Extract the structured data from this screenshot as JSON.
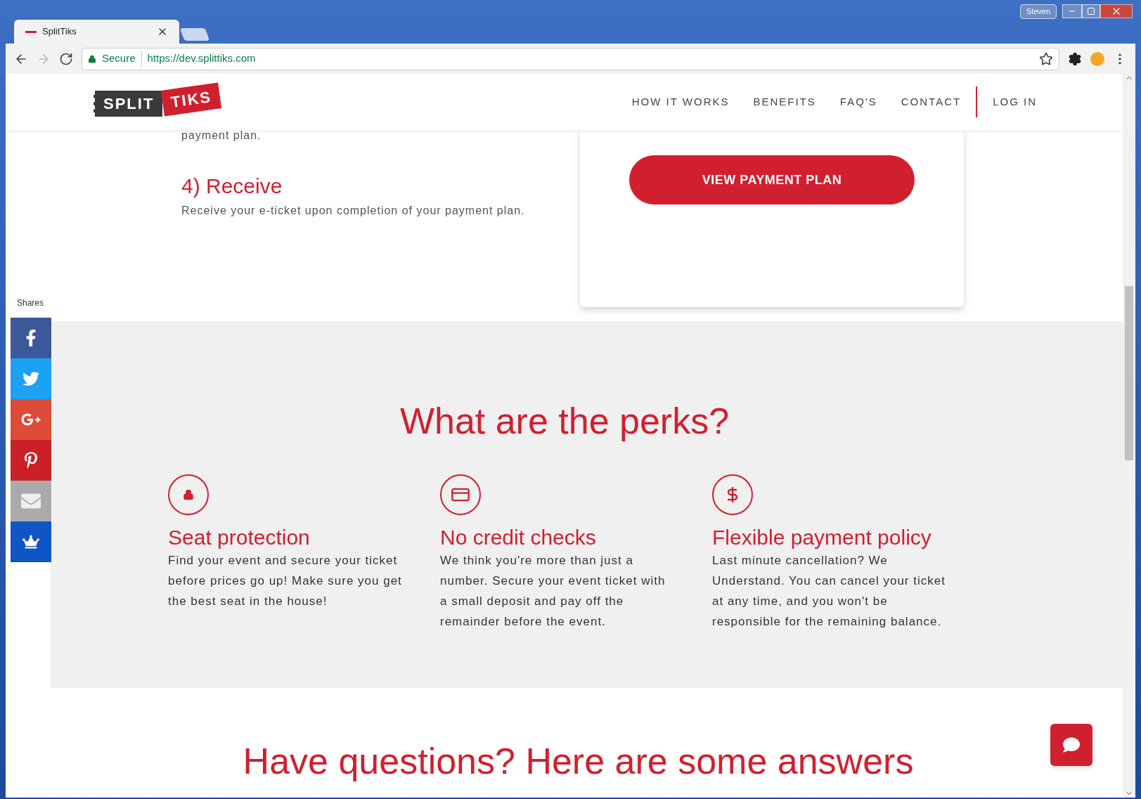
{
  "browser": {
    "tab_title": "SplitTiks",
    "secure_label": "Secure",
    "url": "https://dev.splittiks.com",
    "profile": "Steven"
  },
  "header": {
    "logo": {
      "left": "SPLIT",
      "right": "TIKS"
    },
    "nav": [
      {
        "label": "HOW IT WORKS",
        "kind": "link"
      },
      {
        "label": "BENEFITS",
        "kind": "link"
      },
      {
        "label": "FAQ'S",
        "kind": "link"
      },
      {
        "label": "CONTACT",
        "kind": "link"
      },
      {
        "label": "LOG IN",
        "kind": "login"
      }
    ]
  },
  "steps": {
    "previous_tail": "payment plan.",
    "title": "4) Receive",
    "text": "Receive your e-ticket upon completion of your payment plan."
  },
  "card": {
    "button": "VIEW PAYMENT PLAN"
  },
  "share": {
    "label": "Shares",
    "buttons": [
      {
        "kind": "facebook",
        "color": "#3b5998"
      },
      {
        "kind": "twitter",
        "color": "#1da1f2"
      },
      {
        "kind": "googleplus",
        "color": "#dd4b39"
      },
      {
        "kind": "pinterest",
        "color": "#cb2027"
      },
      {
        "kind": "email",
        "color": "#aaaaaa"
      },
      {
        "kind": "crown",
        "color": "#1155c4"
      }
    ]
  },
  "perks": {
    "title": "What are the perks?",
    "items": [
      {
        "kind": "lock",
        "title": "Seat protection",
        "text": "Find your event and secure your ticket before prices go up! Make sure you get the best seat in the house!"
      },
      {
        "kind": "card",
        "title": "No credit checks",
        "text": "We think you're more than just a number. Secure your event ticket with a small deposit and pay off the remainder before the event."
      },
      {
        "kind": "dollar",
        "title": "Flexible payment policy",
        "text": "Last minute cancellation? We Understand. You can cancel your ticket at any time, and you won't be responsible for the remaining balance."
      }
    ]
  },
  "faq": {
    "title": "Have questions? Here are some answers"
  }
}
